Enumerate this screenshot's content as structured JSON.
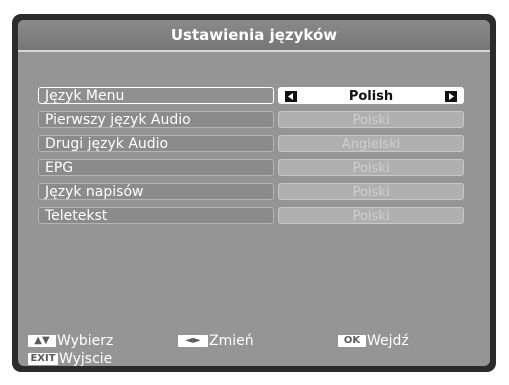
{
  "title": "Ustawienia języków",
  "rows": [
    {
      "label": "Język Menu",
      "value": "Polish"
    },
    {
      "label": "Pierwszy język Audio",
      "value": "Polski"
    },
    {
      "label": "Drugi język Audio",
      "value": "Angielski"
    },
    {
      "label": "EPG",
      "value": "Polski"
    },
    {
      "label": "Język napisów",
      "value": "Polski"
    },
    {
      "label": "Teletekst",
      "value": "Polski"
    }
  ],
  "footer": {
    "select": {
      "key": "▲▼",
      "label": "Wybierz"
    },
    "change": {
      "key": "◄►",
      "label": "Zmień"
    },
    "enter": {
      "key": "OK",
      "label": "Wejdź"
    },
    "exit": {
      "key": "EXIT",
      "label": "Wyjscie"
    }
  },
  "icons": {
    "left_arrow": "triangle-left-icon",
    "right_arrow": "triangle-right-icon"
  },
  "colors": {
    "background": "#959595",
    "title_bar": "#7f7f7f",
    "selected_value": "#ffffff"
  }
}
